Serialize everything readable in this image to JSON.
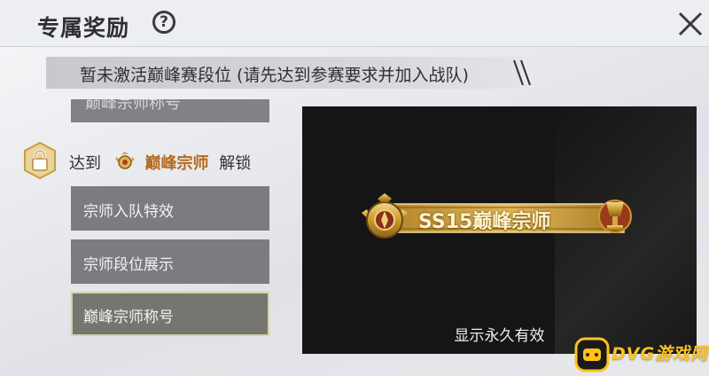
{
  "header": {
    "title": "专属奖励",
    "help_glyph": "?",
    "icons": {
      "help": "question-circle-icon",
      "close": "close-icon"
    }
  },
  "notice": {
    "text": "暂未激活巅峰赛段位 (请先达到参赛要求并加入战队)"
  },
  "reward_list": {
    "prev_item_label": "巅峰宗师称号",
    "unlock": {
      "prefix": "达到",
      "rank": "巅峰宗师",
      "suffix": "解锁",
      "icons": {
        "lock": "lock-icon",
        "rank": "rank-emblem-icon"
      }
    },
    "items": [
      {
        "label": "宗师入队特效"
      },
      {
        "label": "宗师段位展示"
      },
      {
        "label": "巅峰宗师称号",
        "selected": true
      }
    ]
  },
  "preview": {
    "title_badge": "SS15巅峰宗师",
    "caption": "显示永久有效"
  },
  "watermark": {
    "text": "DVG游戏网"
  },
  "colors": {
    "accent_gold": "#c99a2e",
    "rank_text": "#b46a1e",
    "watermark": "#ffc21a"
  }
}
